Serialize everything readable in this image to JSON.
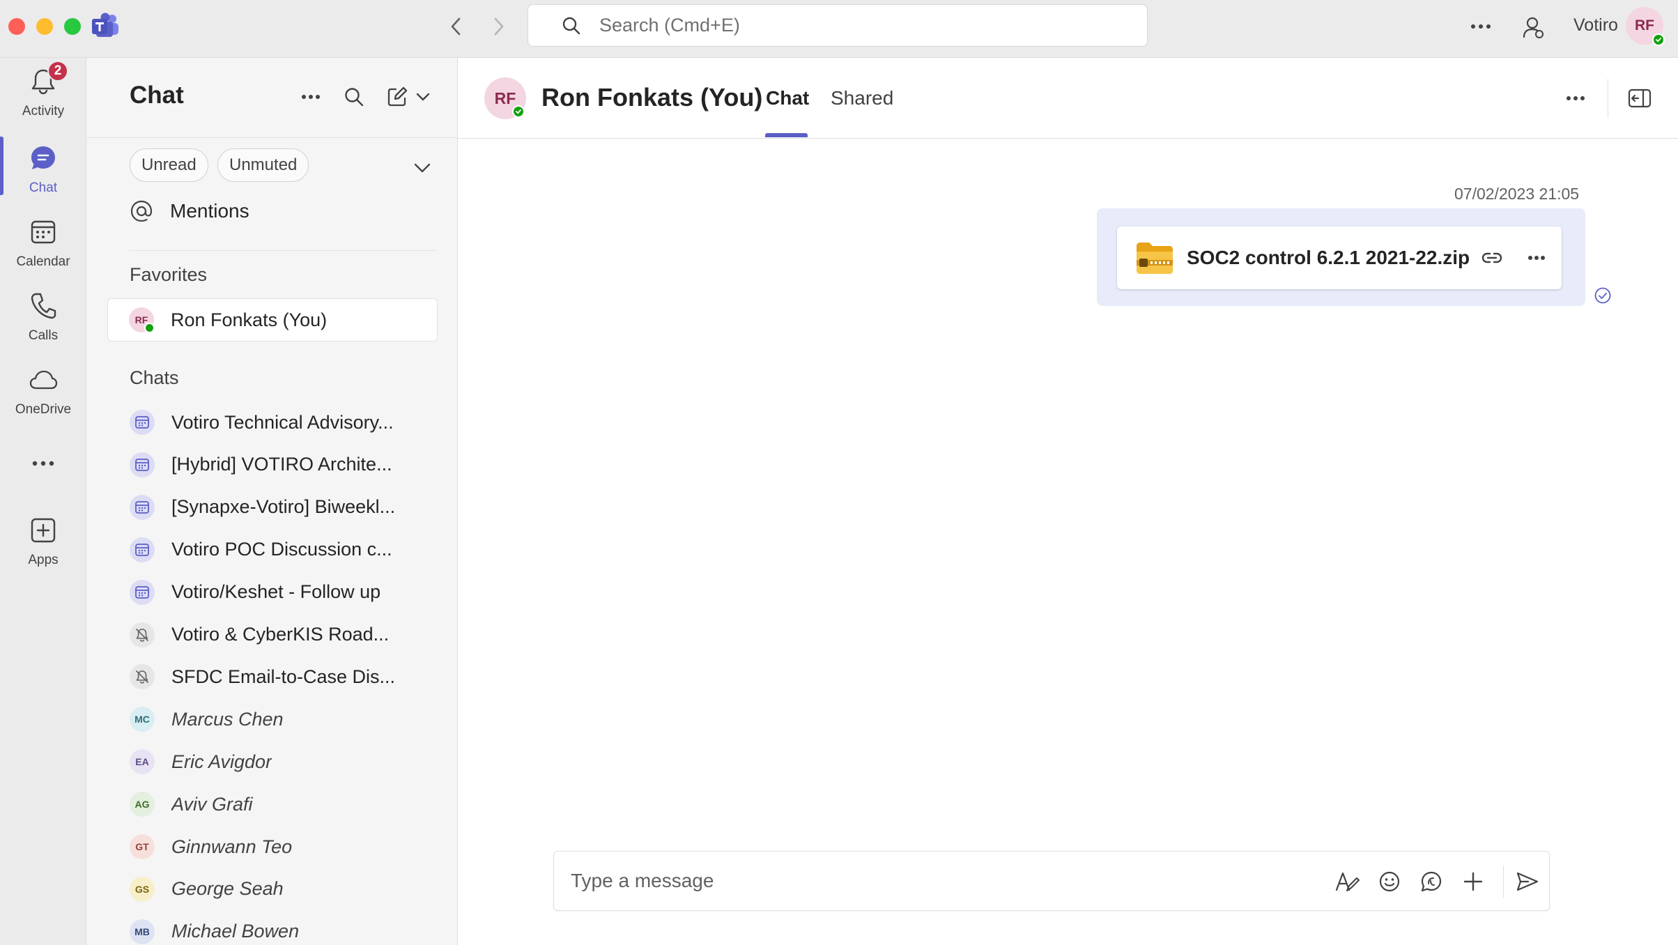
{
  "titlebar": {
    "search_placeholder": "Search (Cmd+E)",
    "org_name": "Votiro",
    "user_initials": "RF"
  },
  "rail": {
    "items": [
      {
        "label": "Activity",
        "icon": "bell-icon",
        "badge": "2"
      },
      {
        "label": "Chat",
        "icon": "chat-icon",
        "active": true
      },
      {
        "label": "Calendar",
        "icon": "calendar-icon"
      },
      {
        "label": "Calls",
        "icon": "phone-icon"
      },
      {
        "label": "OneDrive",
        "icon": "cloud-icon"
      },
      {
        "label": "Apps",
        "icon": "add-app-icon"
      }
    ]
  },
  "chatlist": {
    "title": "Chat",
    "filters": [
      "Unread",
      "Unmuted"
    ],
    "mentions_label": "Mentions",
    "favorites_header": "Favorites",
    "favorites": [
      {
        "name": "Ron Fonkats (You)",
        "initials": "RF"
      }
    ],
    "chats_header": "Chats",
    "chats": [
      {
        "name": "Votiro Technical Advisory...",
        "type": "meeting"
      },
      {
        "name": "[Hybrid] VOTIRO Archite...",
        "type": "meeting"
      },
      {
        "name": "[Synapxe-Votiro] Biweekl...",
        "type": "meeting"
      },
      {
        "name": "Votiro POC Discussion c...",
        "type": "meeting"
      },
      {
        "name": "Votiro/Keshet - Follow up",
        "type": "meeting"
      },
      {
        "name": "Votiro & CyberKIS Road...",
        "type": "muted"
      },
      {
        "name": "SFDC Email-to-Case Dis...",
        "type": "muted"
      },
      {
        "name": "Marcus Chen",
        "type": "person",
        "initials": "MC",
        "color": "#d9eef2",
        "text_color": "#2b6f7a"
      },
      {
        "name": "Eric Avigdor",
        "type": "person",
        "initials": "EA",
        "color": "#e8e3f2",
        "text_color": "#5a4a86"
      },
      {
        "name": "Aviv Grafi",
        "type": "person",
        "initials": "AG",
        "color": "#e3efdf",
        "text_color": "#3f6b2f"
      },
      {
        "name": "Ginnwann Teo",
        "type": "person",
        "initials": "GT",
        "color": "#f7e0dc",
        "text_color": "#94413a"
      },
      {
        "name": "George Seah",
        "type": "person",
        "initials": "GS",
        "color": "#f7efc9",
        "text_color": "#7a6311"
      },
      {
        "name": "Michael Bowen",
        "type": "person",
        "initials": "MB",
        "color": "#dde3f2",
        "text_color": "#34487a"
      }
    ]
  },
  "conversation": {
    "name": "Ron Fonkats (You)",
    "initials": "RF",
    "tabs": [
      "Chat",
      "Shared"
    ],
    "messages": [
      {
        "timestamp": "07/02/2023 21:05",
        "file_name": "SOC2 control 6.2.1 2021-22.zip",
        "file_type": "zip"
      }
    ],
    "composer_placeholder": "Type a message"
  },
  "colors": {
    "accent": "#5b5fc7",
    "badge": "#c4314b",
    "presence": "#13a10e",
    "bubble": "#e8ebfa"
  }
}
